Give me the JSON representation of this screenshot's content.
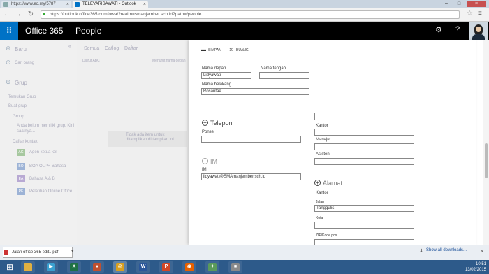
{
  "browser": {
    "tabs": [
      {
        "label": "https://www.eo.my/5787"
      },
      {
        "label": "TELEVARISAWATI - Outlook"
      }
    ],
    "url": "https://outlook.office365.com/owa/?realm=smanjember.sch.id?path=/people",
    "window_controls": [
      "–",
      "□",
      "×"
    ]
  },
  "header": {
    "brand": "Office 365",
    "app": "People",
    "waffle_icon": "⋮⋮⋮"
  },
  "left_pane": {
    "new_label": "Baru",
    "search_label": "Cari orang",
    "groups_label": "Grup",
    "discover_label": "Temukan Grup",
    "new_group_label": "Buat grup",
    "section_label": "Group",
    "hint_text": "Anda belum memiliki grup. Kini saatnya...",
    "list_label": "Daftar kontak",
    "items": [
      {
        "initials": "AG",
        "label": "Agen ketua kel",
        "color": "#a7c8a0"
      },
      {
        "initials": "BO",
        "label": "BOA OLPR Bahasa",
        "color": "#9db3d6"
      },
      {
        "initials": "EA",
        "label": "Bahasa A & B",
        "color": "#b8a9d3"
      },
      {
        "initials": "PE",
        "label": "Pelatihan Online Office",
        "color": "#9db3d6"
      }
    ]
  },
  "middle_pane": {
    "filters": [
      "Semua",
      "Catlog",
      "Daftar"
    ],
    "col1": "Diurut ABC",
    "col2": "Menurut nama depan",
    "empty_message": "Tidak ada item untuk ditampilkan di tampilan ini."
  },
  "form": {
    "save_label": "SIMPAN",
    "discard_label": "BUANG",
    "first_name_label": "Nama depan",
    "first_name_value": "Lidyawati",
    "middle_name_label": "Nama tengah",
    "middle_name_value": "",
    "last_name_label": "Nama belakang",
    "last_name_value": "Rosantae",
    "phone_section": "Telepon",
    "mobile_label": "Ponsel",
    "mobile_value": "",
    "im_section": "IM",
    "im_label": "IM",
    "im_value": "lidyawati@SMAmanjember.sch.id",
    "office_label": "Kantor",
    "manager_label": "Manajer",
    "assistant_label": "Asisten",
    "address_section": "Alamat",
    "address_kind": "Kantor",
    "street_label": "Jalan",
    "street_value": "Tanggulis",
    "city_label": "Kota",
    "zip_label": "ZIP/Kode pos"
  },
  "downloads": {
    "file_label": "Jalan office 365 edit...pdf",
    "show_all_label": "Show all downloads..."
  },
  "taskbar": {
    "apps": [
      {
        "icon": "folder-icon",
        "glyph": "",
        "color": "#e0b040"
      },
      {
        "icon": "media-icon",
        "glyph": "▶",
        "color": "#3aa0d0"
      },
      {
        "icon": "excel-icon",
        "glyph": "X",
        "color": "#1e7145"
      },
      {
        "icon": "paint-icon",
        "glyph": "●",
        "color": "#c05030"
      },
      {
        "icon": "chrome-icon",
        "glyph": "◎",
        "color": "#d9a020"
      },
      {
        "icon": "word-icon",
        "glyph": "W",
        "color": "#2b579a"
      },
      {
        "icon": "powerpoint-icon",
        "glyph": "P",
        "color": "#d24726"
      },
      {
        "icon": "firefox-icon",
        "glyph": "◉",
        "color": "#e66000"
      },
      {
        "icon": "tool-icon",
        "glyph": "✦",
        "color": "#5a9a5a"
      },
      {
        "icon": "app-icon",
        "glyph": "■",
        "color": "#8a8a8a"
      }
    ],
    "time": "10:51",
    "date": "13/02/2015"
  }
}
